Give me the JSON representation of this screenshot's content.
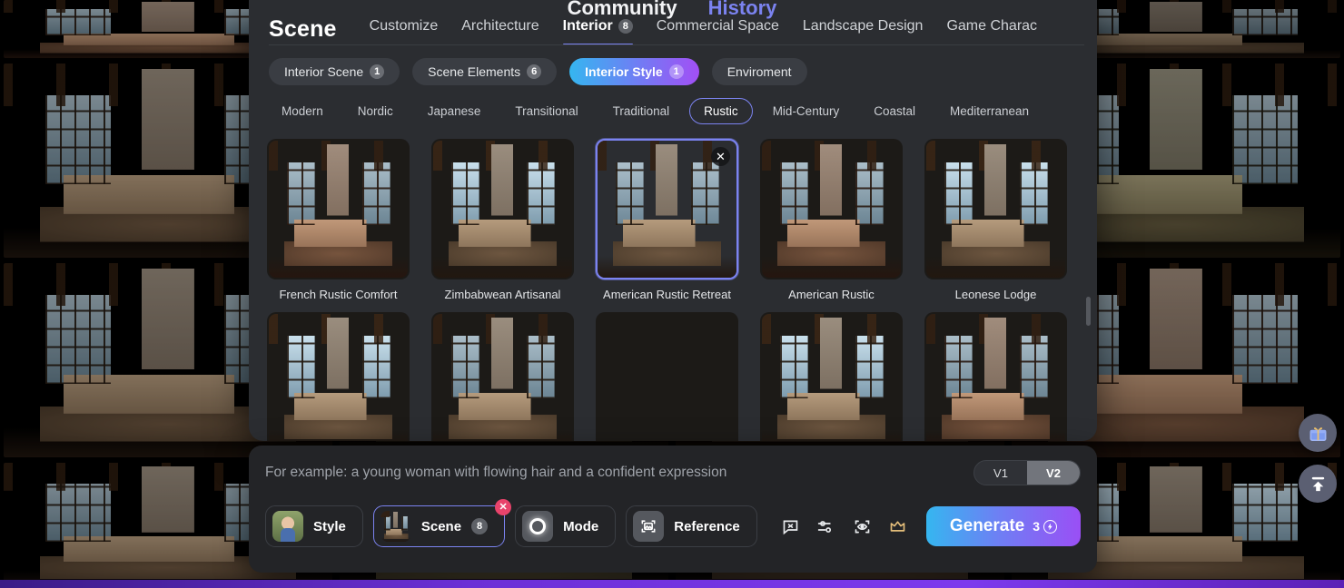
{
  "background_nav": [
    {
      "label": "Community",
      "accent": false
    },
    {
      "label": "History",
      "accent": true
    }
  ],
  "panel": {
    "brand": "Scene",
    "tabs": [
      {
        "label": "Customize",
        "count": null,
        "active": false
      },
      {
        "label": "Architecture",
        "count": null,
        "active": false
      },
      {
        "label": "Interior",
        "count": "8",
        "active": true
      },
      {
        "label": "Commercial Space",
        "count": null,
        "active": false
      },
      {
        "label": "Landscape Design",
        "count": null,
        "active": false
      },
      {
        "label": "Game Charac",
        "count": null,
        "active": false
      }
    ],
    "categories": [
      {
        "label": "Interior Scene",
        "count": "1",
        "active": false
      },
      {
        "label": "Scene Elements",
        "count": "6",
        "active": false
      },
      {
        "label": "Interior Style",
        "count": "1",
        "active": true
      },
      {
        "label": "Enviroment",
        "count": null,
        "active": false
      }
    ],
    "styles": [
      {
        "label": "Modern",
        "active": false
      },
      {
        "label": "Nordic",
        "active": false
      },
      {
        "label": "Japanese",
        "active": false
      },
      {
        "label": "Transitional",
        "active": false
      },
      {
        "label": "Traditional",
        "active": false
      },
      {
        "label": "Rustic",
        "active": true
      },
      {
        "label": "Mid-Century",
        "active": false
      },
      {
        "label": "Coastal",
        "active": false
      },
      {
        "label": "Mediterranean",
        "active": false
      }
    ],
    "cards": [
      {
        "caption": "French Rustic Comfort",
        "selected": false,
        "variant": "leather"
      },
      {
        "caption": "Zimbabwean Artisanal",
        "selected": false,
        "variant": "bright"
      },
      {
        "caption": "American Rustic Retreat",
        "selected": true,
        "variant": "",
        "remove_icon": "✕"
      },
      {
        "caption": "American Rustic",
        "selected": false,
        "variant": "leather"
      },
      {
        "caption": "Leonese Lodge",
        "selected": false,
        "variant": "bright"
      },
      {
        "caption": "",
        "selected": false,
        "variant": "bright"
      },
      {
        "caption": "",
        "selected": false,
        "variant": ""
      },
      {
        "caption": "",
        "selected": false,
        "variant": "dark"
      },
      {
        "caption": "",
        "selected": false,
        "variant": "bright"
      },
      {
        "caption": "",
        "selected": false,
        "variant": "leather"
      }
    ]
  },
  "composer": {
    "prompt_placeholder": "For example: a young woman with flowing hair and a confident expression",
    "prompt_value": "",
    "version_options": [
      {
        "label": "V1",
        "active": false
      },
      {
        "label": "V2",
        "active": true
      }
    ],
    "tools": [
      {
        "label": "Style",
        "count": null,
        "selected": false,
        "tile": "avatar",
        "removable": false
      },
      {
        "label": "Scene",
        "count": "8",
        "selected": true,
        "tile": "scene",
        "removable": true,
        "remove_icon": "✕"
      },
      {
        "label": "Mode",
        "count": null,
        "selected": false,
        "tile": "ring",
        "removable": false
      },
      {
        "label": "Reference",
        "count": null,
        "selected": false,
        "tile": "reference",
        "removable": false
      }
    ],
    "action_icons": [
      {
        "name": "negative-prompt-icon"
      },
      {
        "name": "settings-sliders-icon"
      },
      {
        "name": "eye-scan-icon"
      },
      {
        "name": "crown-icon"
      }
    ],
    "generate": {
      "label": "Generate",
      "cost": "3",
      "coin_symbol": "⚡"
    }
  },
  "rail": [
    {
      "name": "gift-icon"
    },
    {
      "name": "scroll-to-top-icon"
    }
  ],
  "colors": {
    "accent_start": "#35b6f0",
    "accent_mid": "#6f7ef4",
    "accent_end": "#a24ff5",
    "selection_border": "#7b83f0",
    "remove_badge": "#e8436b",
    "crown": "#e3bd7a",
    "panel_bg": "#2b2d31",
    "composer_bg": "#232427",
    "progress_bar": "#7c3aed"
  }
}
